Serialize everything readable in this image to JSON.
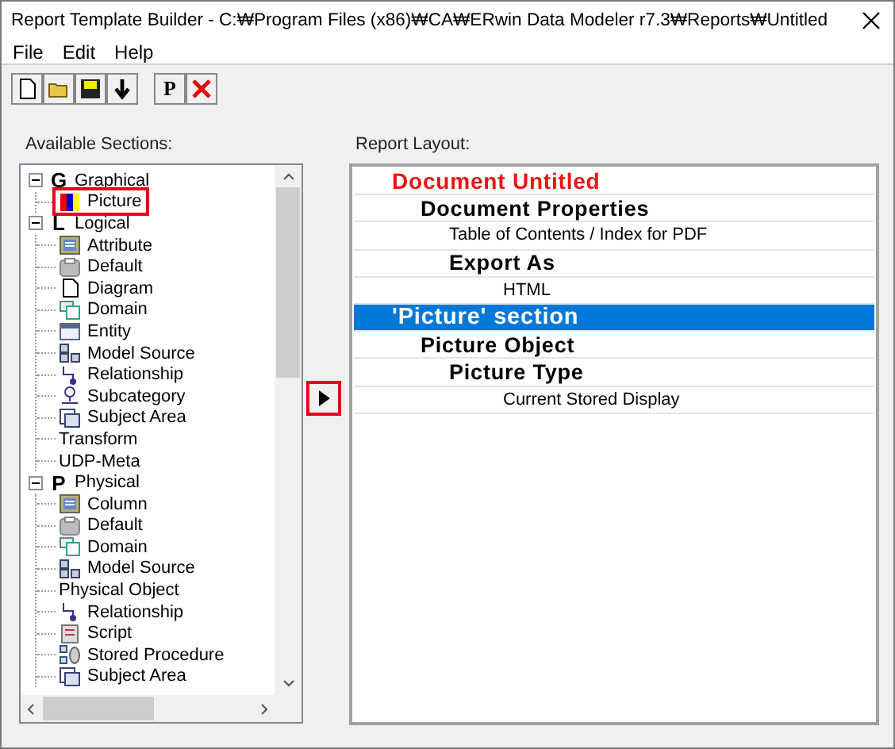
{
  "window": {
    "title": "Report Template Builder - C:₩Program Files (x86)₩CA₩ERwin Data Modeler r7.3₩Reports₩Untitled"
  },
  "menu": [
    "File",
    "Edit",
    "Help"
  ],
  "toolbar": [
    {
      "kind": "new"
    },
    {
      "kind": "open"
    },
    {
      "kind": "save"
    },
    {
      "kind": "download"
    },
    {
      "kind": "text",
      "label": "P"
    },
    {
      "kind": "delete"
    }
  ],
  "available_sections": {
    "label": "Available Sections:",
    "tree": [
      {
        "letter": "G",
        "label": "Graphical",
        "expanded": true,
        "children": [
          {
            "label": "Picture",
            "kind": "picture",
            "highlighted": true
          }
        ]
      },
      {
        "letter": "L",
        "label": "Logical",
        "expanded": true,
        "children": [
          {
            "label": "Attribute",
            "kind": "list",
            "highlighted": false
          },
          {
            "label": "Default",
            "kind": "box",
            "highlighted": false
          },
          {
            "label": "Diagram",
            "kind": "page",
            "highlighted": false
          },
          {
            "label": "Domain",
            "kind": "window",
            "highlighted": false
          },
          {
            "label": "Entity",
            "kind": "table",
            "highlighted": false
          },
          {
            "label": "Model Source",
            "kind": "blocks",
            "highlighted": false
          },
          {
            "label": "Relationship",
            "kind": "connector",
            "highlighted": false
          },
          {
            "label": "Subcategory",
            "kind": "node",
            "highlighted": false
          },
          {
            "label": "Subject Area",
            "kind": "stack",
            "highlighted": false
          },
          {
            "label": "Transform",
            "kind": "plain",
            "highlighted": false
          },
          {
            "label": "UDP-Meta",
            "kind": "plain",
            "highlighted": false
          }
        ]
      },
      {
        "letter": "P",
        "label": "Physical",
        "expanded": true,
        "children": [
          {
            "label": "Column",
            "kind": "list",
            "highlighted": false
          },
          {
            "label": "Default",
            "kind": "box",
            "highlighted": false
          },
          {
            "label": "Domain",
            "kind": "window",
            "highlighted": false
          },
          {
            "label": "Model Source",
            "kind": "blocks",
            "highlighted": false
          },
          {
            "label": "Physical Object",
            "kind": "plain",
            "highlighted": false
          },
          {
            "label": "Relationship",
            "kind": "connector",
            "highlighted": false
          },
          {
            "label": "Script",
            "kind": "form",
            "highlighted": false
          },
          {
            "label": "Stored Procedure",
            "kind": "database",
            "highlighted": false
          },
          {
            "label": "Subject Area",
            "kind": "stack",
            "highlighted": false
          }
        ]
      }
    ]
  },
  "add_button": {
    "highlighted": true
  },
  "report_layout": {
    "label": "Report Layout:",
    "rows": [
      {
        "label": "Document Untitled",
        "kind": "document",
        "selected": false,
        "children": [
          {
            "label": "Document Properties",
            "kind": "heading",
            "selected": false,
            "children": [
              {
                "label": "Table of Contents / Index for PDF",
                "kind": "value",
                "selected": false
              },
              {
                "label": "Export As",
                "kind": "heading",
                "selected": false,
                "children": [
                  {
                    "label": "HTML",
                    "kind": "value",
                    "selected": false
                  }
                ]
              }
            ]
          }
        ]
      },
      {
        "label": "'Picture' section",
        "kind": "section",
        "selected": true,
        "children": [
          {
            "label": "Picture Object",
            "kind": "heading",
            "selected": false,
            "children": [
              {
                "label": "Picture Type",
                "kind": "heading",
                "selected": false,
                "children": [
                  {
                    "label": "Current Stored Display",
                    "kind": "value",
                    "selected": false
                  }
                ]
              }
            ]
          }
        ]
      }
    ]
  }
}
